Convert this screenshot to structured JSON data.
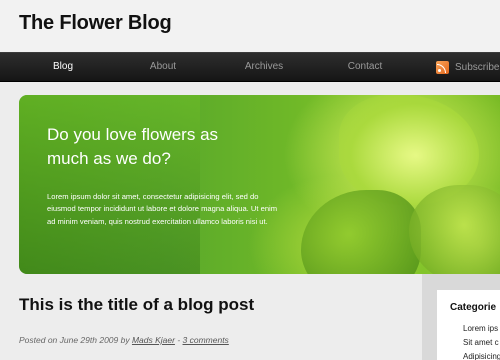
{
  "site": {
    "title": "The Flower Blog"
  },
  "nav": {
    "items": [
      {
        "label": "Blog"
      },
      {
        "label": "About"
      },
      {
        "label": "Archives"
      },
      {
        "label": "Contact"
      }
    ],
    "active": "Blog",
    "subscribe_label": "Subscribe v",
    "subscribe_icon": "rss-icon"
  },
  "hero": {
    "heading": "Do you love flowers as much as we do?",
    "body": "Lorem ipsum dolor sit amet, consectetur adipisicing elit, sed do eiusmod tempor incididunt ut labore et dolore magna aliqua. Ut enim ad minim veniam, quis nostrud exercitation ullamco laboris nisi ut."
  },
  "post": {
    "title": "This is the title of a blog post",
    "meta_prefix": "Posted on June 29th 2009 by ",
    "author": "Mads Kjaer",
    "separator": " - ",
    "comments": "3 comments"
  },
  "sidebar": {
    "heading": "Categorie",
    "links": [
      {
        "label": "Lorem ips"
      },
      {
        "label": "Sit amet c"
      },
      {
        "label": "Adipisicing"
      }
    ]
  },
  "colors": {
    "nav_background": "#1e1e1e",
    "accent_green": "#5aa92a",
    "page_background": "#ededed"
  }
}
